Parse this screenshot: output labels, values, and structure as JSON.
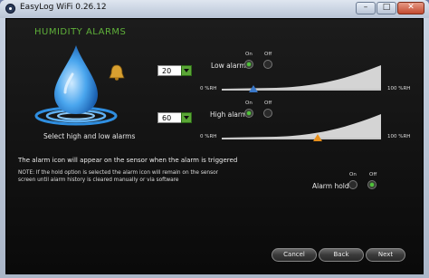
{
  "window": {
    "title": "EasyLog WiFi 0.26.12",
    "minimize_label": "–",
    "maximize_label": "□",
    "close_label": "✕"
  },
  "panel": {
    "heading": "HUMIDITY ALARMS",
    "caption": "Select high and low alarms"
  },
  "low_alarm": {
    "label": "Low alarm",
    "level": "20",
    "on_label": "On",
    "off_label": "Off",
    "selected": "on",
    "scale_min": "0 %RH",
    "scale_max": "100 %RH",
    "thumb_value": 20
  },
  "high_alarm": {
    "label": "High alarm",
    "level": "60",
    "on_label": "On",
    "off_label": "Off",
    "selected": "on",
    "scale_min": "0 %RH",
    "scale_max": "100 %RH",
    "thumb_value": 60
  },
  "info": {
    "line1": "The alarm icon will appear on the sensor when the alarm is triggered",
    "note": "NOTE: If the hold option is selected the alarm icon will remain on the sensor screen until alarm history is cleared manually or via software"
  },
  "alarm_hold": {
    "label": "Alarm hold",
    "on_label": "On",
    "off_label": "Off",
    "selected": "off"
  },
  "buttons": {
    "cancel": "Cancel",
    "back": "Back",
    "next": "Next"
  },
  "colors": {
    "heading": "#5fb03a",
    "low_thumb": "#3a78c8",
    "high_thumb": "#e8901c",
    "radio_on": "#4fc43a"
  }
}
